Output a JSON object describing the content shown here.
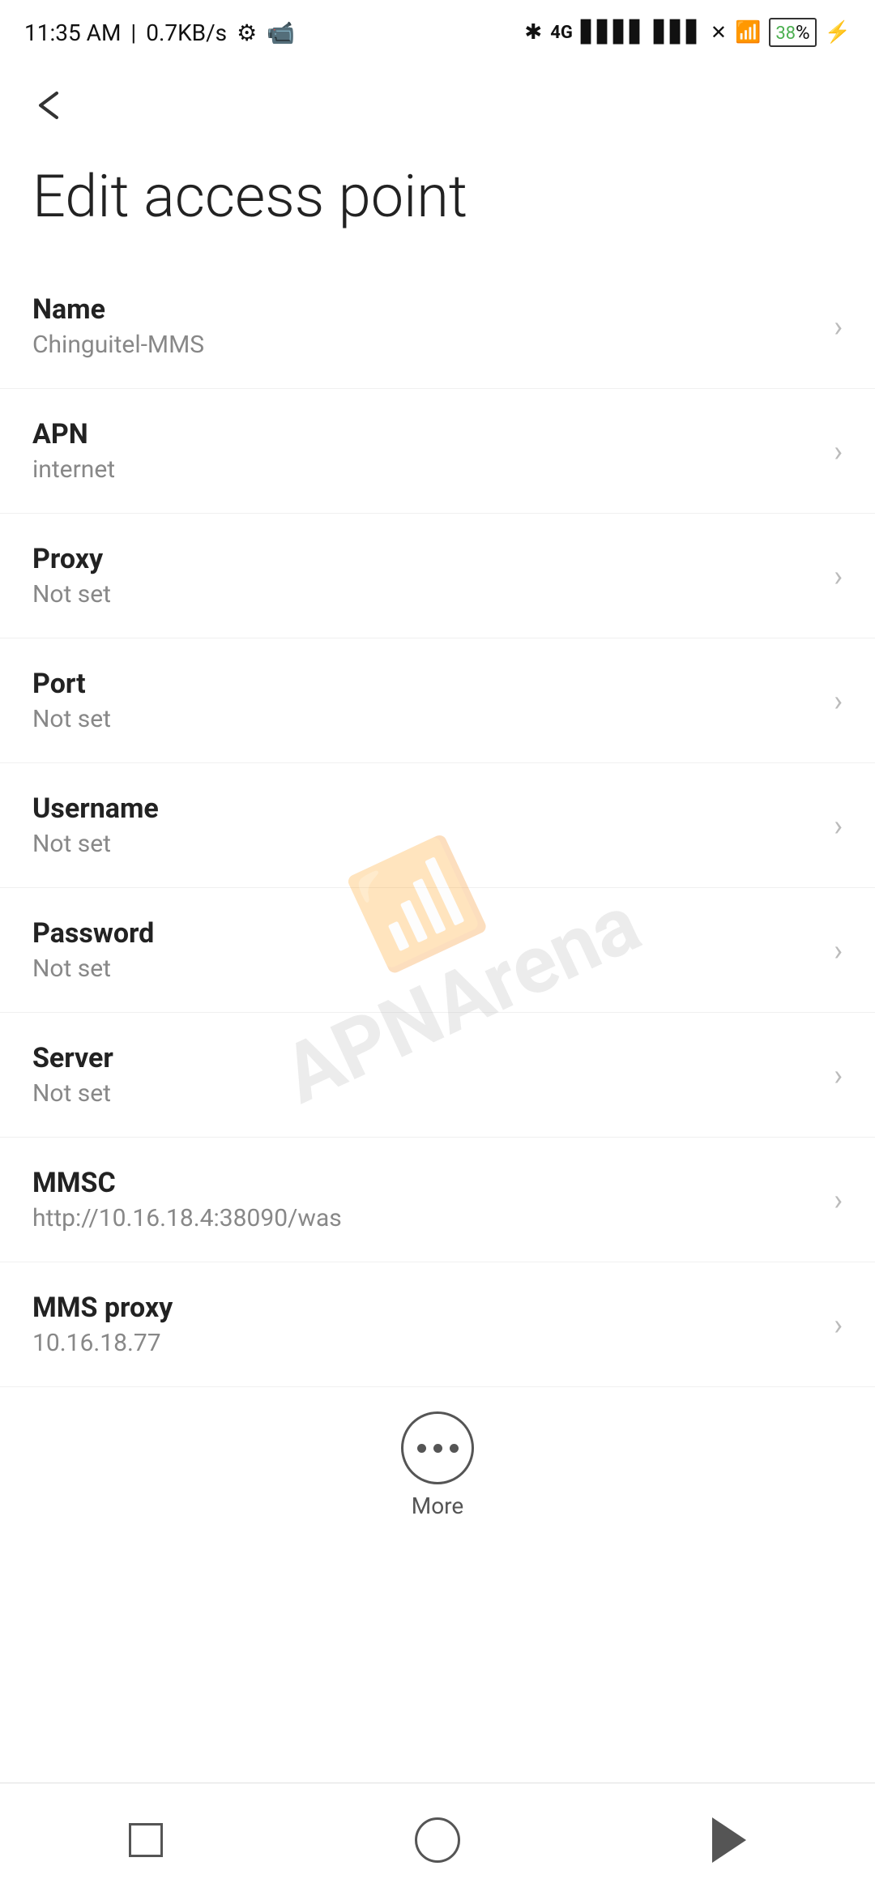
{
  "statusBar": {
    "time": "11:35 AM",
    "speed": "0.7KB/s",
    "battery": "38"
  },
  "toolbar": {
    "backLabel": "←"
  },
  "page": {
    "title": "Edit access point"
  },
  "settings": [
    {
      "label": "Name",
      "value": "Chinguitel-MMS"
    },
    {
      "label": "APN",
      "value": "internet"
    },
    {
      "label": "Proxy",
      "value": "Not set"
    },
    {
      "label": "Port",
      "value": "Not set"
    },
    {
      "label": "Username",
      "value": "Not set"
    },
    {
      "label": "Password",
      "value": "Not set"
    },
    {
      "label": "Server",
      "value": "Not set"
    },
    {
      "label": "MMSC",
      "value": "http://10.16.18.4:38090/was"
    },
    {
      "label": "MMS proxy",
      "value": "10.16.18.77"
    }
  ],
  "more": {
    "label": "More"
  },
  "navBar": {
    "recent": "recent",
    "home": "home",
    "back": "back"
  }
}
